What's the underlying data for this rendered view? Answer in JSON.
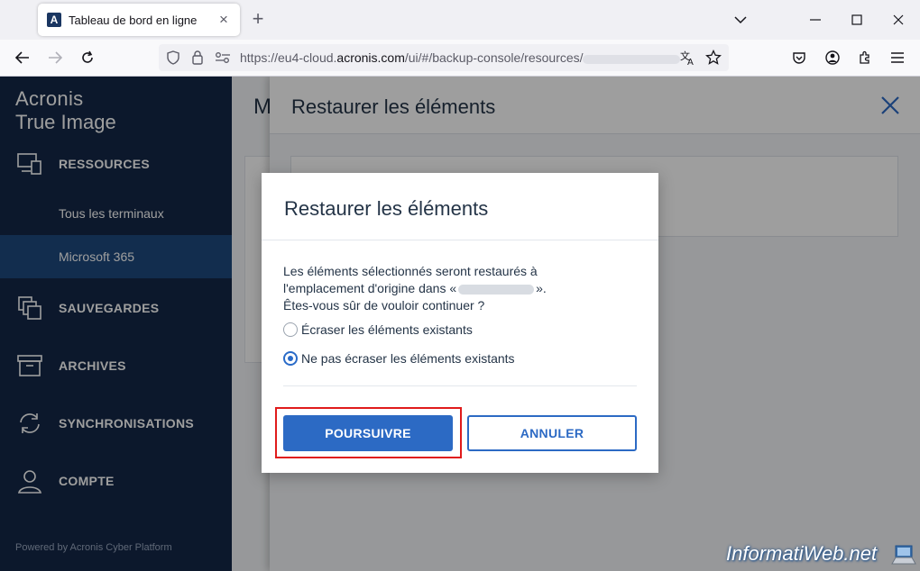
{
  "browser": {
    "tab_title": "Tableau de bord en ligne",
    "tab_favicon_letter": "A",
    "url_prefix": "https://eu4-cloud.",
    "url_domain": "acronis.com",
    "url_path": "/ui/#/backup-console/resources/"
  },
  "sidebar": {
    "brand_line1": "Acronis",
    "brand_line2": "True Image",
    "items": [
      {
        "label": "RESSOURCES",
        "icon": "devices-icon"
      },
      {
        "label": "SAUVEGARDES",
        "icon": "backups-icon"
      },
      {
        "label": "ARCHIVES",
        "icon": "archive-icon"
      },
      {
        "label": "SYNCHRONISATIONS",
        "icon": "sync-icon"
      },
      {
        "label": "COMPTE",
        "icon": "user-icon"
      }
    ],
    "subitems": [
      {
        "label": "Tous les terminaux"
      },
      {
        "label": "Microsoft 365"
      }
    ],
    "powered_by": "Powered by Acronis Cyber Platform"
  },
  "main": {
    "title_initial": "M"
  },
  "drawer": {
    "title": "Restaurer les éléments"
  },
  "modal": {
    "title": "Restaurer les éléments",
    "text_line1": "Les éléments sélectionnés seront restaurés à",
    "text_line2_a": "l'emplacement d'origine dans «",
    "text_line2_b": "».",
    "text_line3": "Êtes-vous sûr de vouloir continuer ?",
    "option_overwrite": "Écraser les éléments existants",
    "option_keep": "Ne pas écraser les éléments existants",
    "primary_label": "POURSUIVRE",
    "secondary_label": "ANNULER"
  },
  "watermark": "InformatiWeb.net",
  "colors": {
    "sidebar_bg": "#142847",
    "sidebar_active": "#1e4a7f",
    "primary": "#2c6ac4",
    "highlight": "#e01b1b"
  }
}
